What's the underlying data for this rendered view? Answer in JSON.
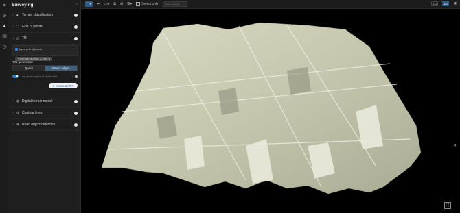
{
  "app": {
    "title": "Surveying"
  },
  "rail": {
    "icons": [
      "layers-icon",
      "settings-icon",
      "terrain-icon",
      "document-icon",
      "history-icon"
    ]
  },
  "panel": {
    "items_top": [
      {
        "label": "Terrain classification",
        "icon": "terrain-class-icon",
        "expanded": false
      },
      {
        "label": "Grid of points",
        "icon": "grid-points-icon",
        "expanded": false
      },
      {
        "label": "TIN",
        "icon": "tin-icon",
        "expanded": true
      }
    ],
    "tin": {
      "input_label": "Input grid of points",
      "input_chip": "Terrain grid of points 1.000m",
      "generation_title": "TIN generation",
      "modes": [
        "Quick",
        "Smart edges"
      ],
      "selected_mode": "Smart edges",
      "toggle_label": "Use vector layers as break lines",
      "toggle_on": true,
      "generate_label": "Generate TIN"
    },
    "items_bottom": [
      {
        "label": "Digital terrain model",
        "icon": "dtm-icon"
      },
      {
        "label": "Contour lines",
        "icon": "contour-icon"
      },
      {
        "label": "Road object detection",
        "icon": "road-icon"
      }
    ]
  },
  "toolbar": {
    "select_only_label": "Select only",
    "point_clouds_placeholder": "Point clouds",
    "view_2d": "2D",
    "view_3d": "3D",
    "active_view": "3D",
    "tools": [
      "select-tool-icon",
      "pin-tool-icon",
      "camera-tool-icon",
      "crop-tool-icon",
      "grid-tool-icon",
      "layers-tool-icon"
    ]
  },
  "viewport": {
    "mesh_color": "#c9cbb2",
    "background": "#000000"
  }
}
